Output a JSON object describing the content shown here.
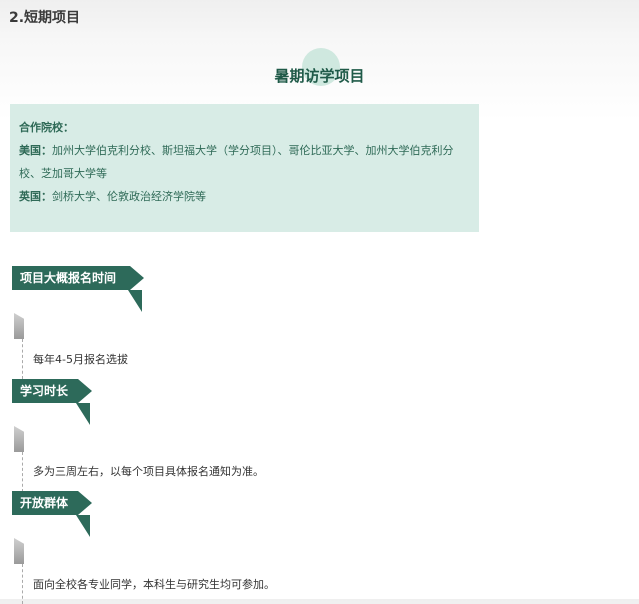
{
  "section_heading": "2.短期项目",
  "main_title": "暑期访学项目",
  "partners": {
    "header": "合作院校：",
    "usa_label": "美国：",
    "usa_text": "加州大学伯克利分校、斯坦福大学（学分项目）、哥伦比亚大学、加州大学伯克利分校、芝加哥大学等",
    "uk_label": "英国：",
    "uk_text": "剑桥大学、伦敦政治经济学院等"
  },
  "sections": [
    {
      "title": "项目大概报名时间",
      "text": "每年4-5月报名选拔"
    },
    {
      "title": "学习时长",
      "text": "多为三周左右，以每个项目具体报名通知为准。"
    },
    {
      "title": "开放群体",
      "text": "面向全校各专业同学，本科生与研究生均可参加。"
    }
  ],
  "colors": {
    "accent": "#2d6a5a",
    "box_bg": "#d8ece6",
    "title_circle": "#cfe8df"
  }
}
